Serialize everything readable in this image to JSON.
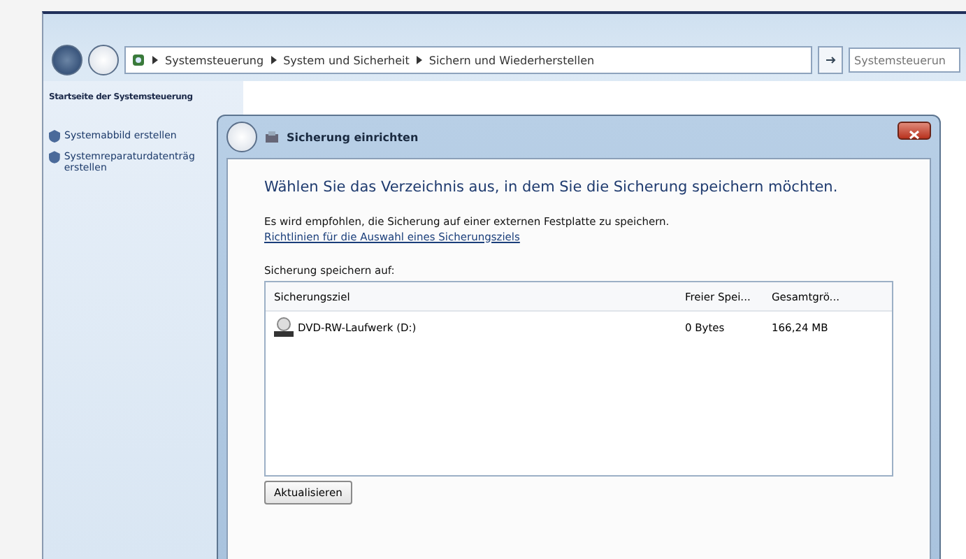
{
  "address_bar": {
    "breadcrumbs": [
      "Systemsteuerung",
      "System und Sicherheit",
      "Sichern und Wiederherstellen"
    ],
    "search": {
      "placeholder": "Systemsteuerun"
    }
  },
  "sidebar": {
    "home_link": "Startseite der Systemsteuerung",
    "items": [
      "Systemabbild erstellen",
      "Systemreparaturdatenträg erstellen"
    ]
  },
  "dialog": {
    "title": "Sicherung einrichten",
    "heading": "Wählen Sie das Verzeichnis aus, in dem Sie die Sicherung speichern möchten.",
    "recommendation": "Es wird empfohlen, die Sicherung auf einer externen Festplatte zu speichern.",
    "link": "Richtlinien für die Auswahl eines Sicherungsziels",
    "list_label": "Sicherung speichern auf:",
    "table": {
      "columns": [
        "Sicherungsziel",
        "Freier Spei...",
        "Gesamtgrö..."
      ],
      "rows": [
        {
          "cells": [
            "DVD-RW-Laufwerk (D:)",
            "0 Bytes",
            "166,24 MB"
          ],
          "selected": false
        }
      ]
    },
    "buttons": [
      "Aktualisieren"
    ]
  }
}
